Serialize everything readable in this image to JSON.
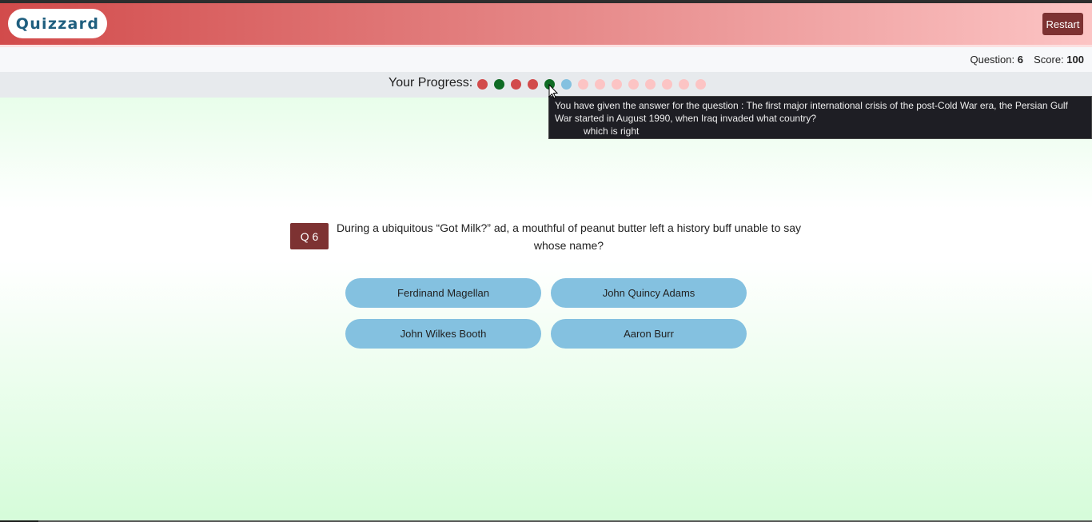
{
  "header": {
    "brand": "Quizzard",
    "restart_label": "Restart"
  },
  "status": {
    "question_label": "Question:",
    "question_value": "6",
    "score_label": "Score:",
    "score_value": "100"
  },
  "progress": {
    "label": "Your Progress:",
    "dots": [
      {
        "state": "wrong",
        "color": "#d24b4b"
      },
      {
        "state": "right",
        "color": "#0f6b24"
      },
      {
        "state": "wrong",
        "color": "#d24b4b"
      },
      {
        "state": "wrong",
        "color": "#d24b4b"
      },
      {
        "state": "right",
        "color": "#0f6b24"
      },
      {
        "state": "current",
        "color": "#84c1e0"
      },
      {
        "state": "pending",
        "color": "#fcc4c4"
      },
      {
        "state": "pending",
        "color": "#fcc4c4"
      },
      {
        "state": "pending",
        "color": "#fcc4c4"
      },
      {
        "state": "pending",
        "color": "#fcc4c4"
      },
      {
        "state": "pending",
        "color": "#fcc4c4"
      },
      {
        "state": "pending",
        "color": "#fcc4c4"
      },
      {
        "state": "pending",
        "color": "#fcc4c4"
      },
      {
        "state": "pending",
        "color": "#fcc4c4"
      }
    ]
  },
  "tooltip": {
    "line1": "You have given the answer for the question : The first major international crisis of the post-Cold War era, the Persian Gulf War started in August 1990, when Iraq invaded what country?",
    "line2": "which is right"
  },
  "question": {
    "badge": "Q 6",
    "text": "During a ubiquitous “Got Milk?” ad, a mouthful of peanut butter left a history buff unable to say whose name?",
    "answers": [
      "Ferdinand Magellan",
      "John Quincy Adams",
      "John Wilkes Booth",
      "Aaron Burr"
    ]
  }
}
